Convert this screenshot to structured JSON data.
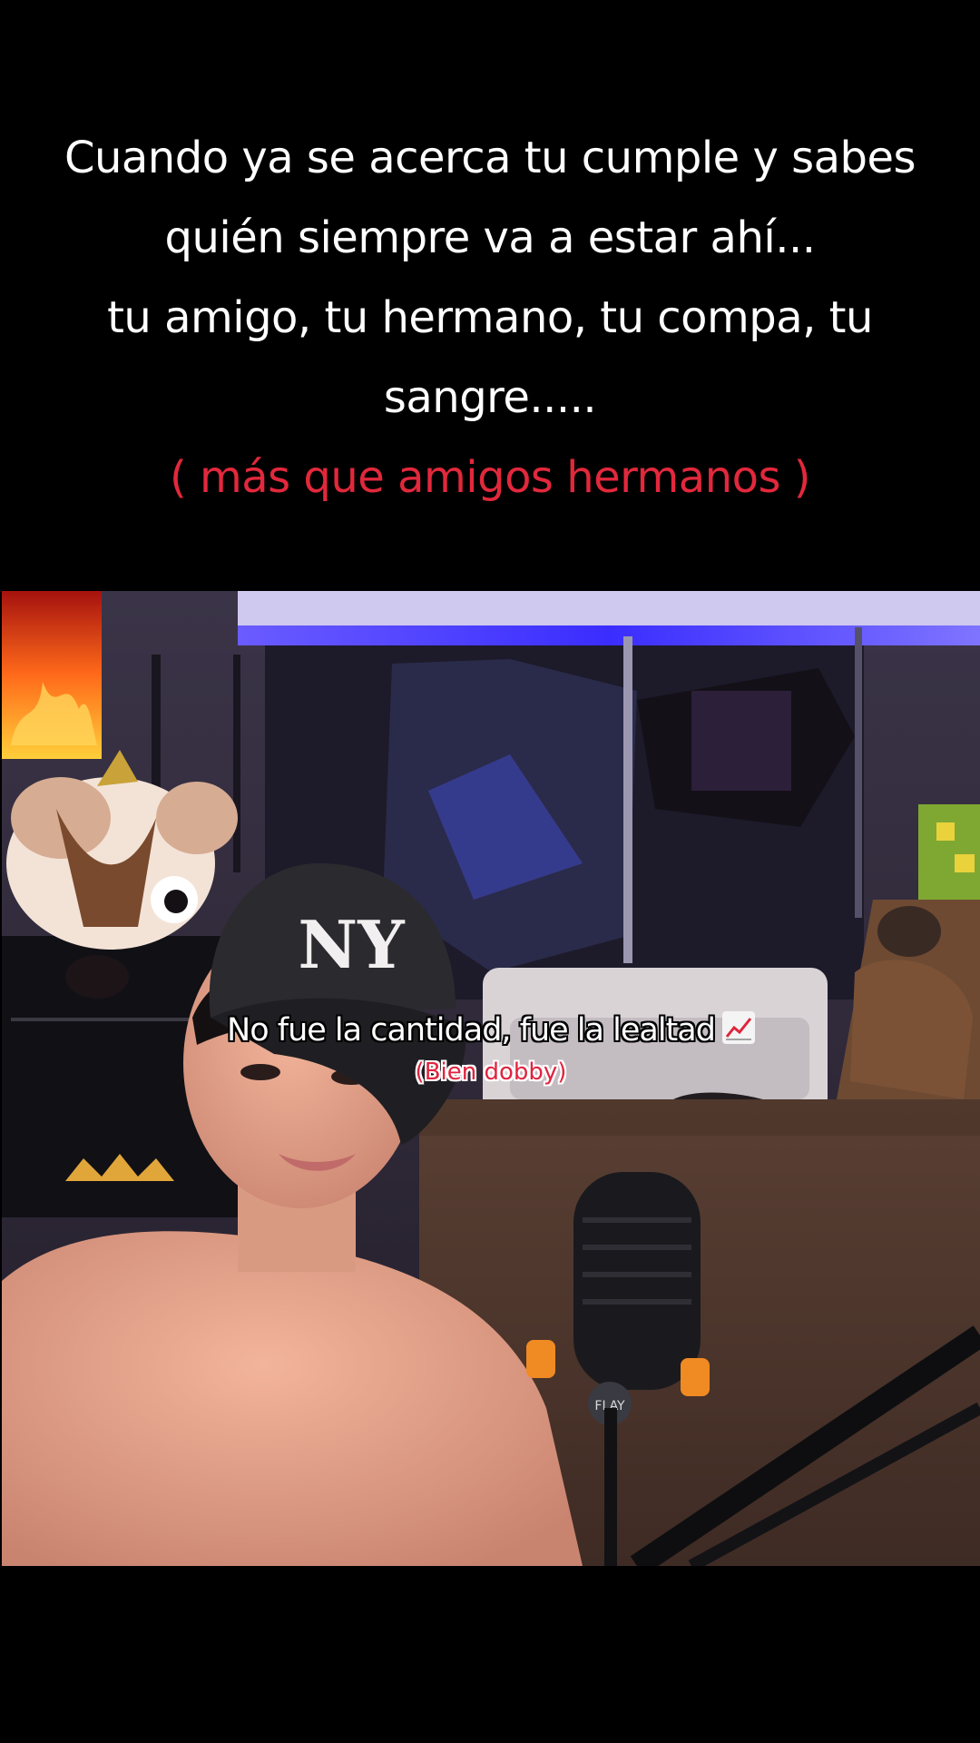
{
  "caption": {
    "lines": [
      "Cuando ya se acerca tu cumple y sabes",
      "quién siempre va a estar ahí...",
      "tu amigo, tu hermano, tu compa, tu",
      "sangre....."
    ],
    "highlight": "( más que amigos hermanos )",
    "highlight_color": "#e2283c",
    "text_color": "#ffffff"
  },
  "video": {
    "subtitle_main": "No fue la cantidad, fue la lealtad",
    "subtitle_emoji_icon": "chart-increasing-icon",
    "subtitle_secondary": "(Bien dobby)",
    "subtitle_secondary_color": "#e0243f",
    "cap_logo_text": "NY",
    "mic_logo_text": "FLAY"
  },
  "colors": {
    "background": "#000000",
    "led_light": "#4a3cff"
  }
}
